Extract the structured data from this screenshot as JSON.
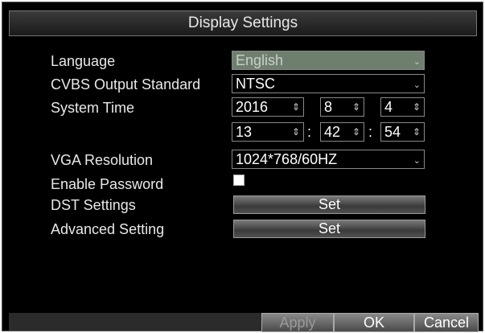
{
  "dialog": {
    "title": "Display Settings"
  },
  "language": {
    "label": "Language",
    "value": "English"
  },
  "cvbs": {
    "label": "CVBS Output Standard",
    "value": "NTSC"
  },
  "system_time": {
    "label": "System Time",
    "year": "2016",
    "month": "8",
    "day": "4",
    "hour": "13",
    "minute": "42",
    "second": "54",
    "separator": ":"
  },
  "vga": {
    "label": "VGA Resolution",
    "value": "1024*768/60HZ"
  },
  "password": {
    "label": "Enable Password",
    "checked": true
  },
  "dst": {
    "label": "DST Settings",
    "button": "Set"
  },
  "advanced": {
    "label": "Advanced Setting",
    "button": "Set"
  },
  "footer": {
    "apply": "Apply",
    "ok": "OK",
    "cancel": "Cancel"
  },
  "icons": {
    "dropdown": "chevron-down-icon",
    "spinner": "spinner-icon"
  },
  "colors": {
    "background": "#000000",
    "disabled_field": "#6f7f6f",
    "button": "#5a5a5a"
  }
}
